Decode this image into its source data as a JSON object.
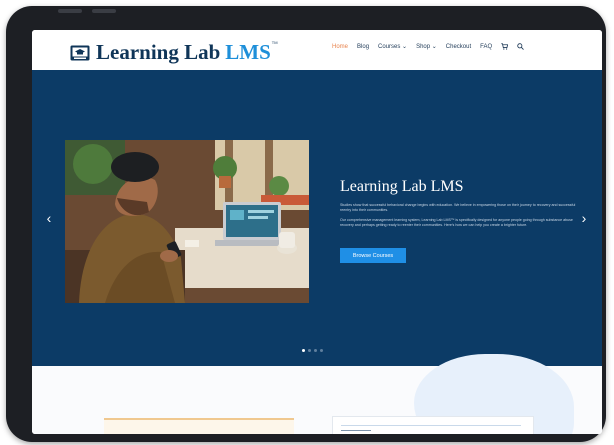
{
  "site": {
    "logo_text": "Learning Lab",
    "logo_accent": "LMS",
    "logo_mark": "TM",
    "icons": {
      "logo": "graduation-cap-icon",
      "cart": "cart-icon",
      "search": "search-icon"
    }
  },
  "nav": {
    "items": [
      {
        "label": "Home",
        "active": true
      },
      {
        "label": "Blog",
        "active": false
      },
      {
        "label": "Courses ⌄",
        "active": false
      },
      {
        "label": "Shop ⌄",
        "active": false
      },
      {
        "label": "Checkout",
        "active": false
      },
      {
        "label": "FAQ",
        "active": false
      }
    ]
  },
  "hero": {
    "title": "Learning Lab LMS",
    "paragraph_1": "Studies show that successful behavioral change begins with education. We believe in empowering those on their journey to recovery and successful reentry into their communities.",
    "paragraph_2": "Our comprehensive management learning system, Learning Lab LMS™ is specifically designed for anyone people going through substance abuse recovery and perhaps getting ready to reenter their communities. Here's how we can help you create a brighter future.",
    "button_label": "Browse Courses",
    "prev_arrow": "‹",
    "next_arrow": "›",
    "slide_count": 4,
    "active_slide": 1
  },
  "colors": {
    "hero_bg": "#0c3b66",
    "brand": "#0f3558",
    "accent": "#1e8fd9",
    "nav_active": "#e8844e",
    "button": "#1f8fe6",
    "device": "#1d1f24"
  }
}
